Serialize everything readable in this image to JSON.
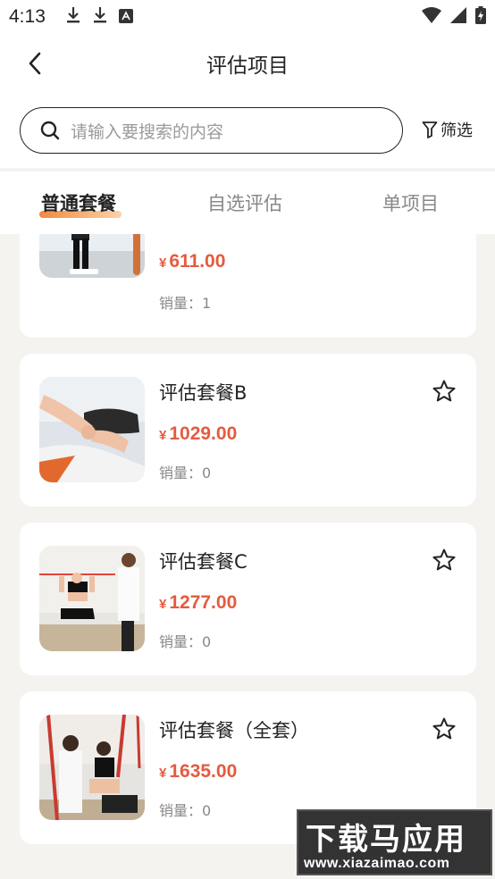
{
  "status_bar": {
    "time": "4:13"
  },
  "header": {
    "title": "评估项目",
    "back_icon": "chevron-left-icon"
  },
  "search": {
    "placeholder": "请输入要搜索的内容",
    "filter_label": "筛选"
  },
  "tabs": [
    {
      "label": "普通套餐",
      "active": true
    },
    {
      "label": "自选评估",
      "active": false
    },
    {
      "label": "单项目",
      "active": false
    }
  ],
  "packages": [
    {
      "name": "",
      "currency": "¥",
      "price": "611.00",
      "sales_label": "销量：",
      "sales": "1"
    },
    {
      "name": "评估套餐B",
      "currency": "¥",
      "price": "1029.00",
      "sales_label": "销量：",
      "sales": "0"
    },
    {
      "name": "评估套餐C",
      "currency": "¥",
      "price": "1277.00",
      "sales_label": "销量：",
      "sales": "0"
    },
    {
      "name": "评估套餐（全套）",
      "currency": "¥",
      "price": "1635.00",
      "sales_label": "销量：",
      "sales": "0"
    }
  ],
  "watermark": {
    "line1": "下载马应用",
    "line2": "www.xiazaimao.com"
  },
  "colors": {
    "price": "#e45b3f",
    "accent": "#f08a3e"
  }
}
